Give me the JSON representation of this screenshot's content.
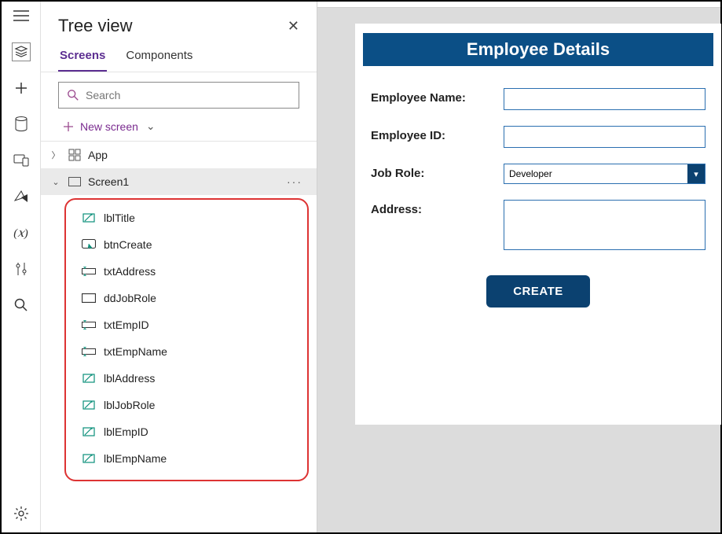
{
  "rail": {
    "items": [
      "menu",
      "layers",
      "add",
      "db",
      "devices",
      "shapes",
      "var",
      "tune",
      "search",
      "gear"
    ]
  },
  "panel": {
    "title": "Tree view",
    "tabs": {
      "screens": "Screens",
      "components": "Components"
    },
    "search_placeholder": "Search",
    "new_screen": "New screen",
    "app_node": "App",
    "screen_node": "Screen1",
    "children": [
      {
        "icon": "label",
        "name": "lblTitle"
      },
      {
        "icon": "button",
        "name": "btnCreate"
      },
      {
        "icon": "text",
        "name": "txtAddress"
      },
      {
        "icon": "rect",
        "name": "ddJobRole"
      },
      {
        "icon": "text",
        "name": "txtEmpID"
      },
      {
        "icon": "text",
        "name": "txtEmpName"
      },
      {
        "icon": "label",
        "name": "lblAddress"
      },
      {
        "icon": "label",
        "name": "lblJobRole"
      },
      {
        "icon": "label",
        "name": "lblEmpID"
      },
      {
        "icon": "label",
        "name": "lblEmpName"
      }
    ]
  },
  "form": {
    "title": "Employee Details",
    "empname_label": "Employee Name:",
    "empid_label": "Employee ID:",
    "jobrole_label": "Job Role:",
    "jobrole_value": "Developer",
    "address_label": "Address:",
    "create_button": "CREATE"
  }
}
